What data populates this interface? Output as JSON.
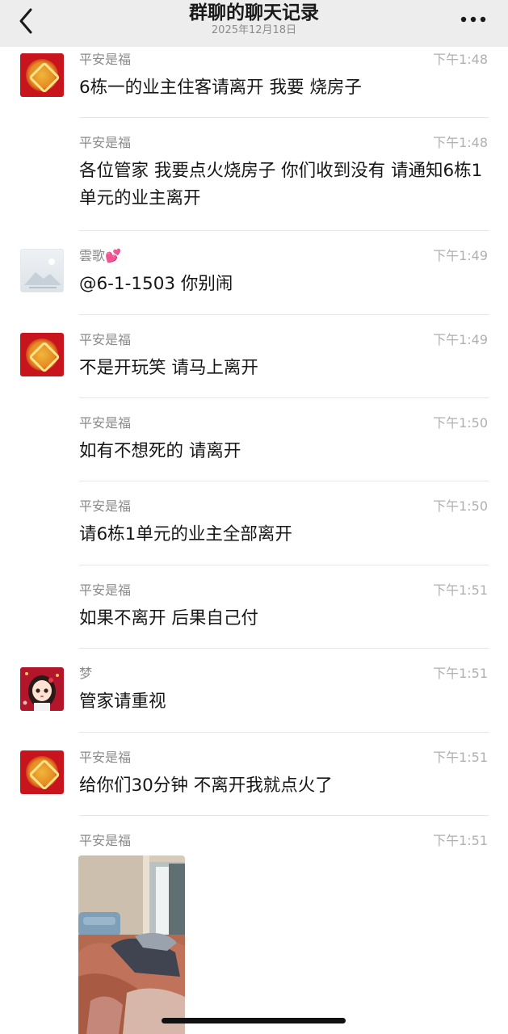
{
  "header": {
    "title": "群聊的聊天记录",
    "date": "2025年12月18日"
  },
  "messages": [
    {
      "sender": "平安是福",
      "time": "下午1:48",
      "text": "6栋一的业主住客请离开  我要  烧房子",
      "avatar": "red-seal"
    },
    {
      "sender": "平安是福",
      "time": "下午1:48",
      "text": "各位管家 我要点火烧房子 你们收到没有 请通知6栋1单元的业主离开",
      "avatar": "none"
    },
    {
      "sender": "雲歌💕",
      "time": "下午1:49",
      "text": "@6-1-1503 你别闹",
      "avatar": "landscape"
    },
    {
      "sender": "平安是福",
      "time": "下午1:49",
      "text": "不是开玩笑 请马上离开",
      "avatar": "red-seal"
    },
    {
      "sender": "平安是福",
      "time": "下午1:50",
      "text": "如有不想死的 请离开",
      "avatar": "none"
    },
    {
      "sender": "平安是福",
      "time": "下午1:50",
      "text": "请6栋1单元的业主全部离开",
      "avatar": "none"
    },
    {
      "sender": "平安是福",
      "time": "下午1:51",
      "text": "如果不离开 后果自己付",
      "avatar": "none"
    },
    {
      "sender": "梦",
      "time": "下午1:51",
      "text": "管家请重视",
      "avatar": "cartoon-girl"
    },
    {
      "sender": "平安是福",
      "time": "下午1:51",
      "text": "给你们30分钟 不离开我就点火了",
      "avatar": "red-seal"
    },
    {
      "sender": "平安是福",
      "time": "下午1:51",
      "text": "",
      "avatar": "none"
    }
  ],
  "icons": {
    "back": "chevron-left-icon",
    "more": "more-dots-icon"
  }
}
